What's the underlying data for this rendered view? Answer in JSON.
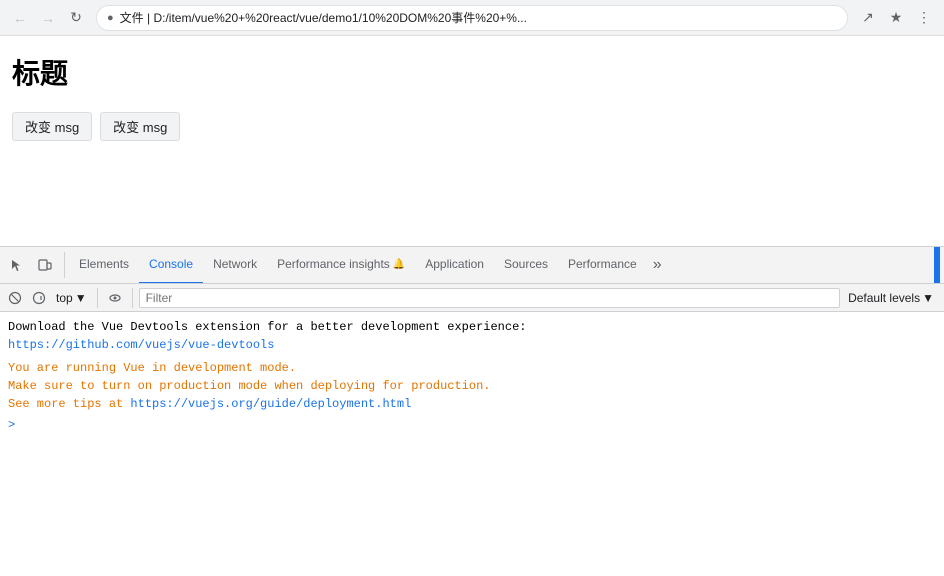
{
  "browser": {
    "address": "文件 | D:/item/vue%20+%20react/vue/demo1/10%20DOM%20事件%20+%...",
    "address_display": "文件  |  D:/item/vue%20+%20react/vue/demo1/10%20DOM%20事件%20+%..."
  },
  "page": {
    "title": "标题",
    "btn1": "改变 msg",
    "btn2": "改变 msg"
  },
  "devtools": {
    "tabs": [
      {
        "label": "Elements",
        "active": false
      },
      {
        "label": "Console",
        "active": true
      },
      {
        "label": "Network",
        "active": false
      },
      {
        "label": "Performance insights",
        "active": false,
        "has_bell": true
      },
      {
        "label": "Application",
        "active": false
      },
      {
        "label": "Sources",
        "active": false
      },
      {
        "label": "Performance",
        "active": false
      }
    ],
    "more_label": "»",
    "console_toolbar": {
      "top_label": "top",
      "dropdown_arrow": "▼",
      "filter_placeholder": "Filter",
      "default_levels": "Default levels",
      "dropdown_arrow2": "▼"
    },
    "console_lines": [
      {
        "type": "text",
        "text": "Download the Vue Devtools extension for a better development experience:",
        "link": "https://github.com/vuejs/vue-devtools",
        "link_text": "https://github.com/vuejs/vue-devtools"
      },
      {
        "type": "warn",
        "text1": "You are running Vue in development mode.",
        "text2": "Make sure to turn on production mode when deploying for production.",
        "text3": "See more tips at ",
        "link": "https://vuejs.org/guide/deployment.html",
        "link_text": "https://vuejs.org/guide/deployment.html"
      }
    ],
    "prompt_symbol": ">"
  }
}
